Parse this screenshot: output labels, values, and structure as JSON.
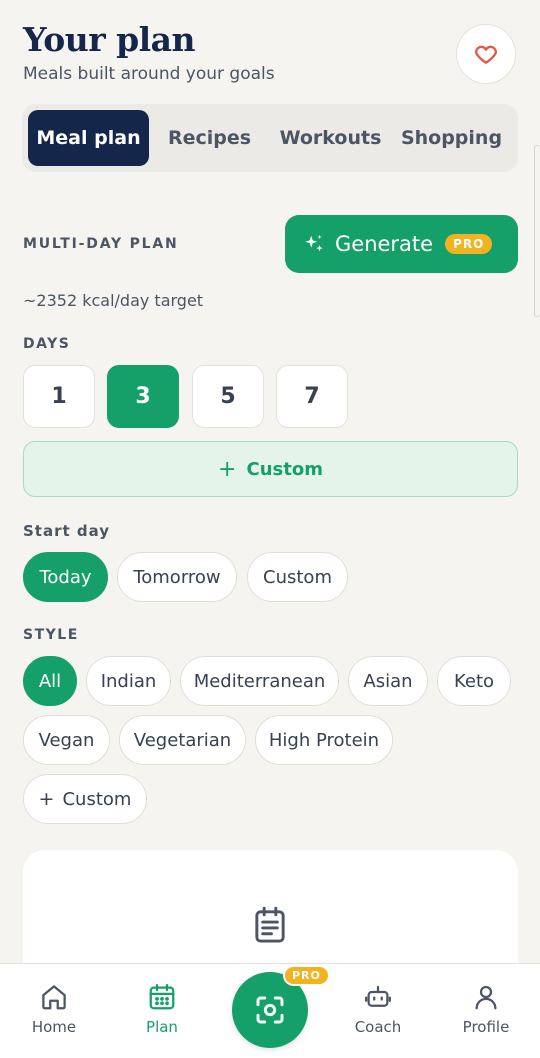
{
  "header": {
    "title": "Your plan",
    "subtitle": "Meals built around your goals"
  },
  "tabs": [
    {
      "label": "Meal plan",
      "active": true
    },
    {
      "label": "Recipes",
      "active": false
    },
    {
      "label": "Workouts",
      "active": false
    },
    {
      "label": "Shopping",
      "active": false
    }
  ],
  "plan": {
    "section_label": "MULTI-DAY PLAN",
    "generate_label": "Generate",
    "pro_badge": "PRO",
    "kcal_target": "~2352 kcal/day target"
  },
  "days": {
    "label": "DAYS",
    "options": [
      "1",
      "3",
      "5",
      "7"
    ],
    "selected": "3",
    "custom_label": "Custom"
  },
  "start_day": {
    "label": "Start day",
    "options": [
      "Today",
      "Tomorrow",
      "Custom"
    ],
    "selected": "Today"
  },
  "style": {
    "label": "STYLE",
    "options": [
      "All",
      "Indian",
      "Mediterranean",
      "Asian",
      "Keto",
      "Vegan",
      "Vegetarian",
      "High Protein"
    ],
    "selected": "All",
    "custom_label": "Custom"
  },
  "nav": {
    "items": [
      "Home",
      "Plan",
      "Coach",
      "Profile"
    ],
    "active": "Plan",
    "scan_badge": "PRO"
  },
  "colors": {
    "primary": "#15a06a",
    "navy": "#14264a",
    "pro": "#f2b321",
    "heart": "#e05a47"
  }
}
